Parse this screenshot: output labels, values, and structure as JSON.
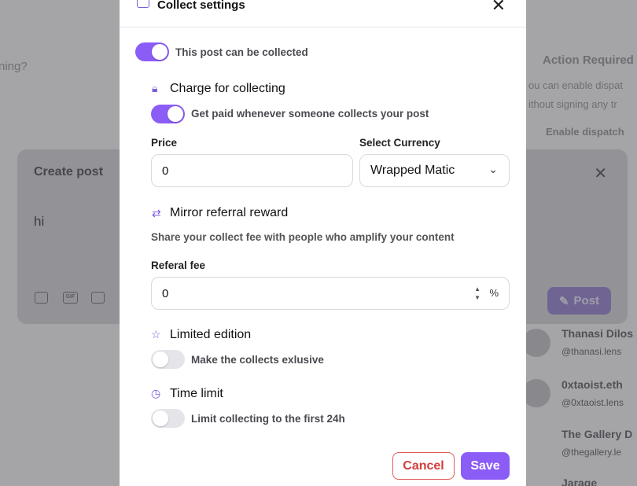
{
  "background": {
    "left_snippet_1": "ning?",
    "side_heading": "Action Required",
    "side_line_1": "ou can enable dispat",
    "side_line_2": "ithout signing any tr",
    "side_button": "Enable dispatch",
    "side_users": [
      {
        "name": "Thanasi Dilos",
        "handle": "@thanasi.lens"
      },
      {
        "name": "0xtaoist.eth",
        "handle": "@0xtaoist.lens"
      },
      {
        "name": "The Gallery D",
        "handle": "@thegallery.le"
      },
      {
        "name": "Jarage",
        "handle": ""
      }
    ]
  },
  "create_post": {
    "title": "Create post",
    "body": "hi",
    "post_label": "Post",
    "gif_label": "GIF"
  },
  "modal": {
    "title": "Collect settings",
    "collectable_label": "This post can be collected",
    "charge": {
      "title": "Charge for collecting",
      "toggle_label": "Get paid whenever someone collects your post",
      "price_label": "Price",
      "price_value": "0",
      "currency_label": "Select Currency",
      "currency_value": "Wrapped Matic"
    },
    "mirror": {
      "title": "Mirror referral reward",
      "description": "Share your collect fee with people who amplify your content",
      "fee_label": "Referal fee",
      "fee_value": "0",
      "fee_unit": "%"
    },
    "limited": {
      "title": "Limited edition",
      "toggle_label": "Make the collects exlusive"
    },
    "time": {
      "title": "Time limit",
      "toggle_label": "Limit collecting to the first 24h"
    },
    "cancel_label": "Cancel",
    "save_label": "Save"
  },
  "colors": {
    "accent": "#8b5cf6",
    "danger": "#d43c3c"
  },
  "toggles": {
    "collectable": true,
    "charge": true,
    "limited": false,
    "time_limit": false
  }
}
